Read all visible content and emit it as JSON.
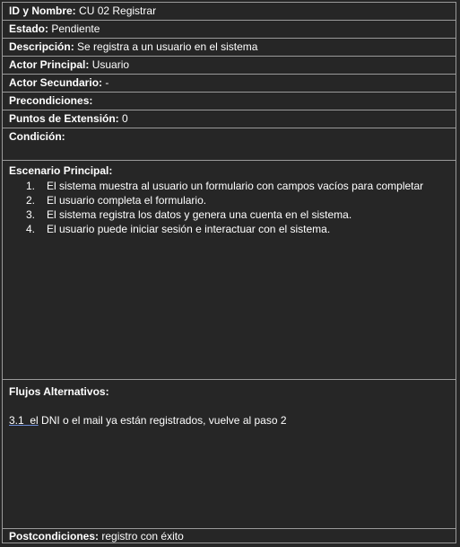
{
  "fields": {
    "id": {
      "label": "ID y Nombre:",
      "value": "CU 02 Registrar"
    },
    "estado": {
      "label": "Estado:",
      "value": "Pendiente"
    },
    "descripcion": {
      "label": "Descripción:",
      "value": "Se registra a un usuario en el sistema"
    },
    "actor_principal": {
      "label": "Actor Principal:",
      "value": "Usuario"
    },
    "actor_secundario": {
      "label": "Actor Secundario:",
      "value": "-"
    },
    "precondiciones": {
      "label": "Precondiciones:",
      "value": ""
    },
    "puntos_extension": {
      "label": "Puntos de Extensión:",
      "value": "0"
    },
    "condicion": {
      "label": "Condición:",
      "value": ""
    }
  },
  "escenario": {
    "label": "Escenario Principal:",
    "steps": [
      {
        "num": "1.",
        "text": "El sistema muestra al usuario un formulario con campos vacíos para completar"
      },
      {
        "num": "2.",
        "text": "El usuario completa el formulario."
      },
      {
        "num": "3.",
        "text": "El sistema registra los datos y genera una cuenta en el sistema."
      },
      {
        "num": "4.",
        "text": "El usuario puede iniciar sesión e interactuar con el sistema."
      }
    ]
  },
  "flujos": {
    "label": "Flujos Alternativos:",
    "item_ref": "3.1",
    "item_word": "el",
    "item_text": "DNI o el mail ya están registrados, vuelve al paso 2"
  },
  "postcondiciones": {
    "label": "Postcondiciones:",
    "value": "registro con éxito"
  }
}
